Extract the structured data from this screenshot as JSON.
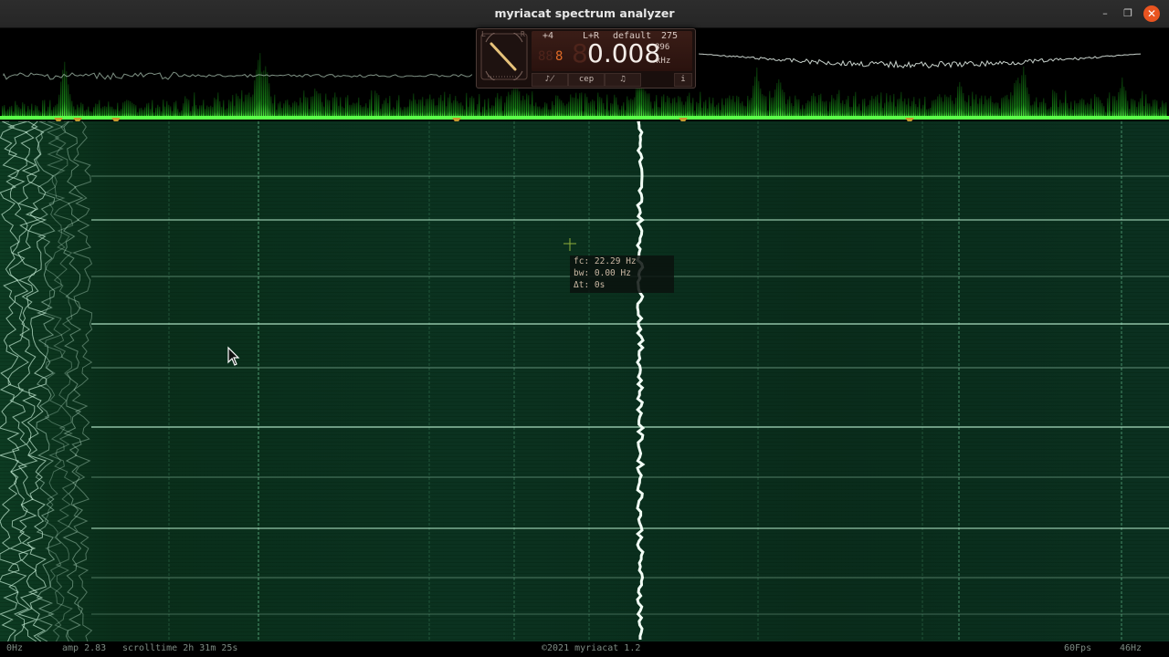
{
  "window": {
    "title": "myriacat spectrum analyzer",
    "buttons": {
      "minimize": "–",
      "maximize": "❐",
      "close": "✕"
    }
  },
  "widget": {
    "gain": "+4",
    "channel": "L+R",
    "preset": "default",
    "preset_number": "275",
    "digit_small": "8",
    "frequency": "0.008",
    "frequency_sub": "896",
    "unit": "kHz",
    "dial_label_top": "L",
    "dial_label_right": "R",
    "tabs": [
      "♪̸",
      "cep",
      "♫",
      "i"
    ]
  },
  "cursor_tooltip": {
    "fc": "fc: 22.29 Hz",
    "bw": "bw: 0.00 Hz",
    "dt": "Δt: 0s"
  },
  "statusbar": {
    "freq_min": "0Hz",
    "amp": "amp 2.83",
    "scrolltime": "scrolltime 2h 31m 25s",
    "copyright": "©2021 myriacat 1.2",
    "fps": "60Fps",
    "freq_max": "46Hz"
  },
  "colors": {
    "spectrum": "#3dff3d",
    "waterfall_line": "#cfffe3",
    "marker": "#c99a2e",
    "close_button": "#e95420"
  }
}
